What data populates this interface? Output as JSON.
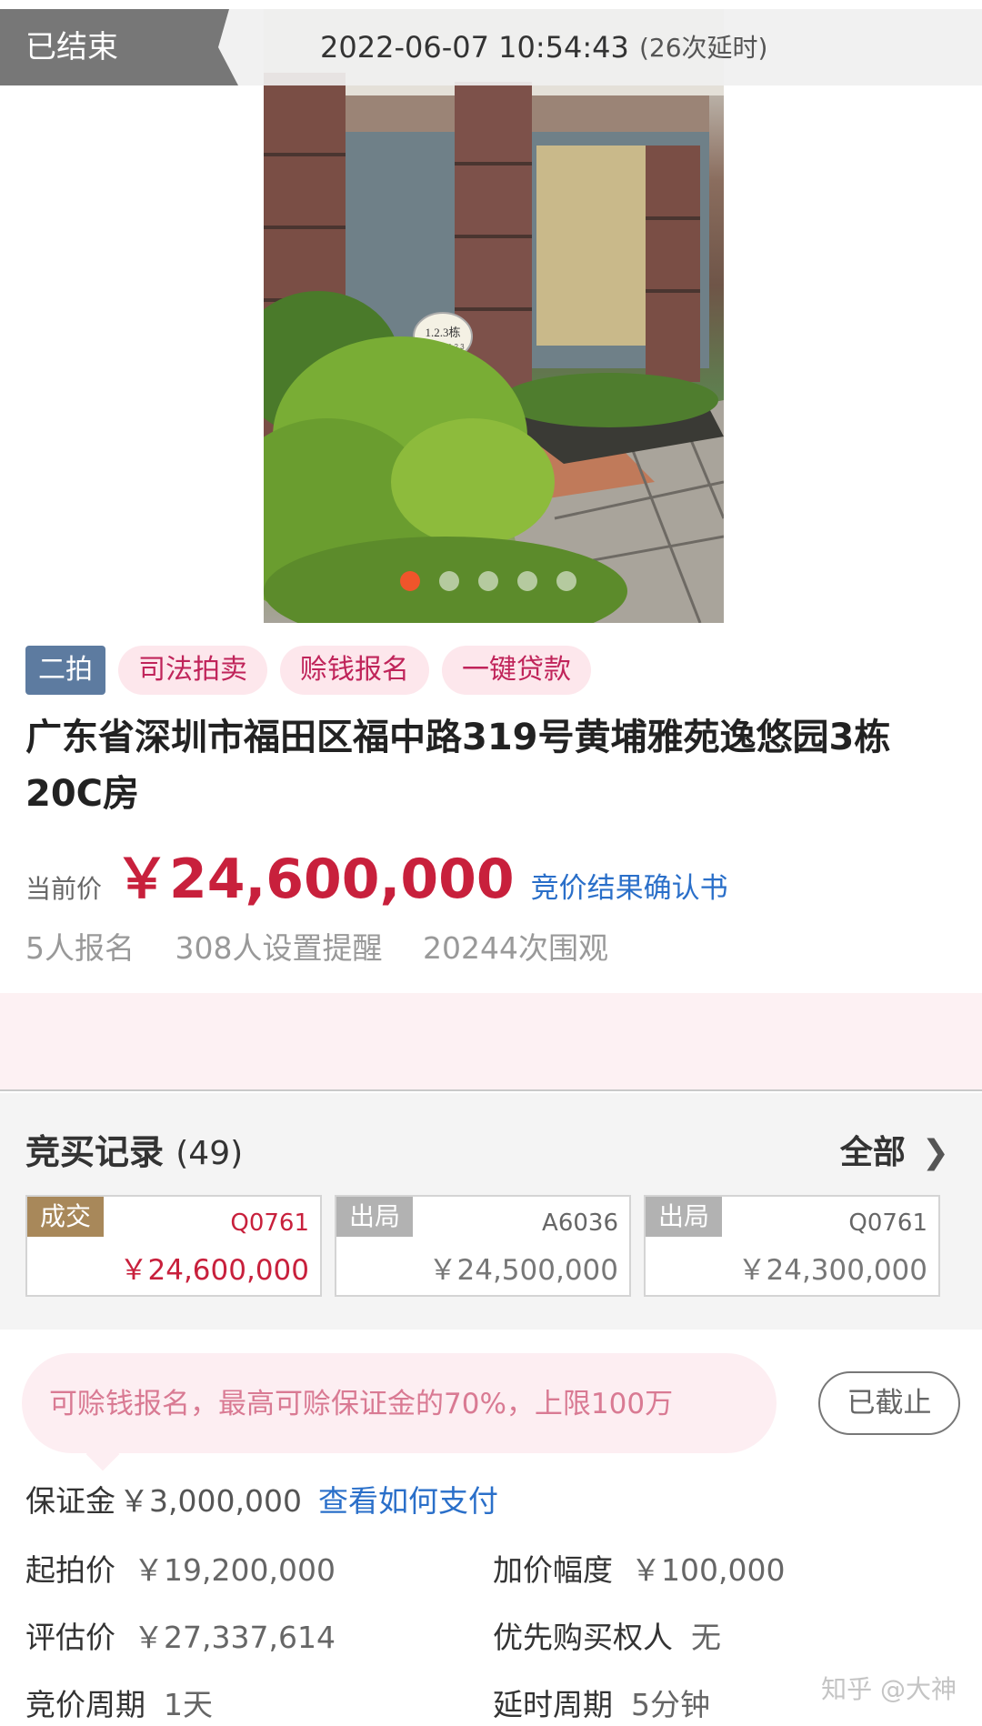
{
  "header": {
    "status": "已结束",
    "end_time": "2022-06-07 10:54:43",
    "delay_note": "(26次延时)"
  },
  "carousel": {
    "slides": 5,
    "active_index": 0,
    "sign_text": "1.2.3栋",
    "sign_subtext": "BLOCK 1,2,3"
  },
  "tags": [
    "二拍",
    "司法拍卖",
    "赊钱报名",
    "一键贷款"
  ],
  "title": "广东省深圳市福田区福中路319号黄埔雅苑逸悠园3栋20C房",
  "price": {
    "label": "当前价",
    "value": "￥24,600,000",
    "link": "竞价结果确认书"
  },
  "stats": {
    "signups": "5人报名",
    "reminders": "308人设置提醒",
    "views": "20244次围观"
  },
  "records": {
    "title": "竞买记录",
    "count": "(49)",
    "all_label": "全部",
    "bids": [
      {
        "tag": "成交",
        "code": "Q0761",
        "price": "￥24,600,000",
        "winner": true
      },
      {
        "tag": "出局",
        "code": "A6036",
        "price": "￥24,500,000",
        "winner": false
      },
      {
        "tag": "出局",
        "code": "Q0761",
        "price": "￥24,300,000",
        "winner": false
      }
    ]
  },
  "deposit_tip": {
    "text": "可赊钱报名，最高可赊保证金的70%，上限100万",
    "button": "已截止"
  },
  "deposit": {
    "label": "保证金",
    "amount": "￥3,000,000",
    "link": "查看如何支付"
  },
  "details": {
    "start_price_label": "起拍价",
    "start_price": "￥19,200,000",
    "increment_label": "加价幅度",
    "increment": "￥100,000",
    "appraisal_label": "评估价",
    "appraisal": "￥27,337,614",
    "priority_label": "优先购买权人",
    "priority": "无",
    "period_label": "竞价周期",
    "period": "1天",
    "delay_label": "延时周期",
    "delay": "5分钟"
  },
  "watermark": "知乎 @大神",
  "colors": {
    "price_red": "#c8203c",
    "link_blue": "#2a6fc9",
    "tag_pink_bg": "#fde7ec",
    "tag_pink_text": "#c0245a",
    "round_tag": "#5d7ba0",
    "win_tag": "#a8885a",
    "active_dot": "#f0552b"
  }
}
